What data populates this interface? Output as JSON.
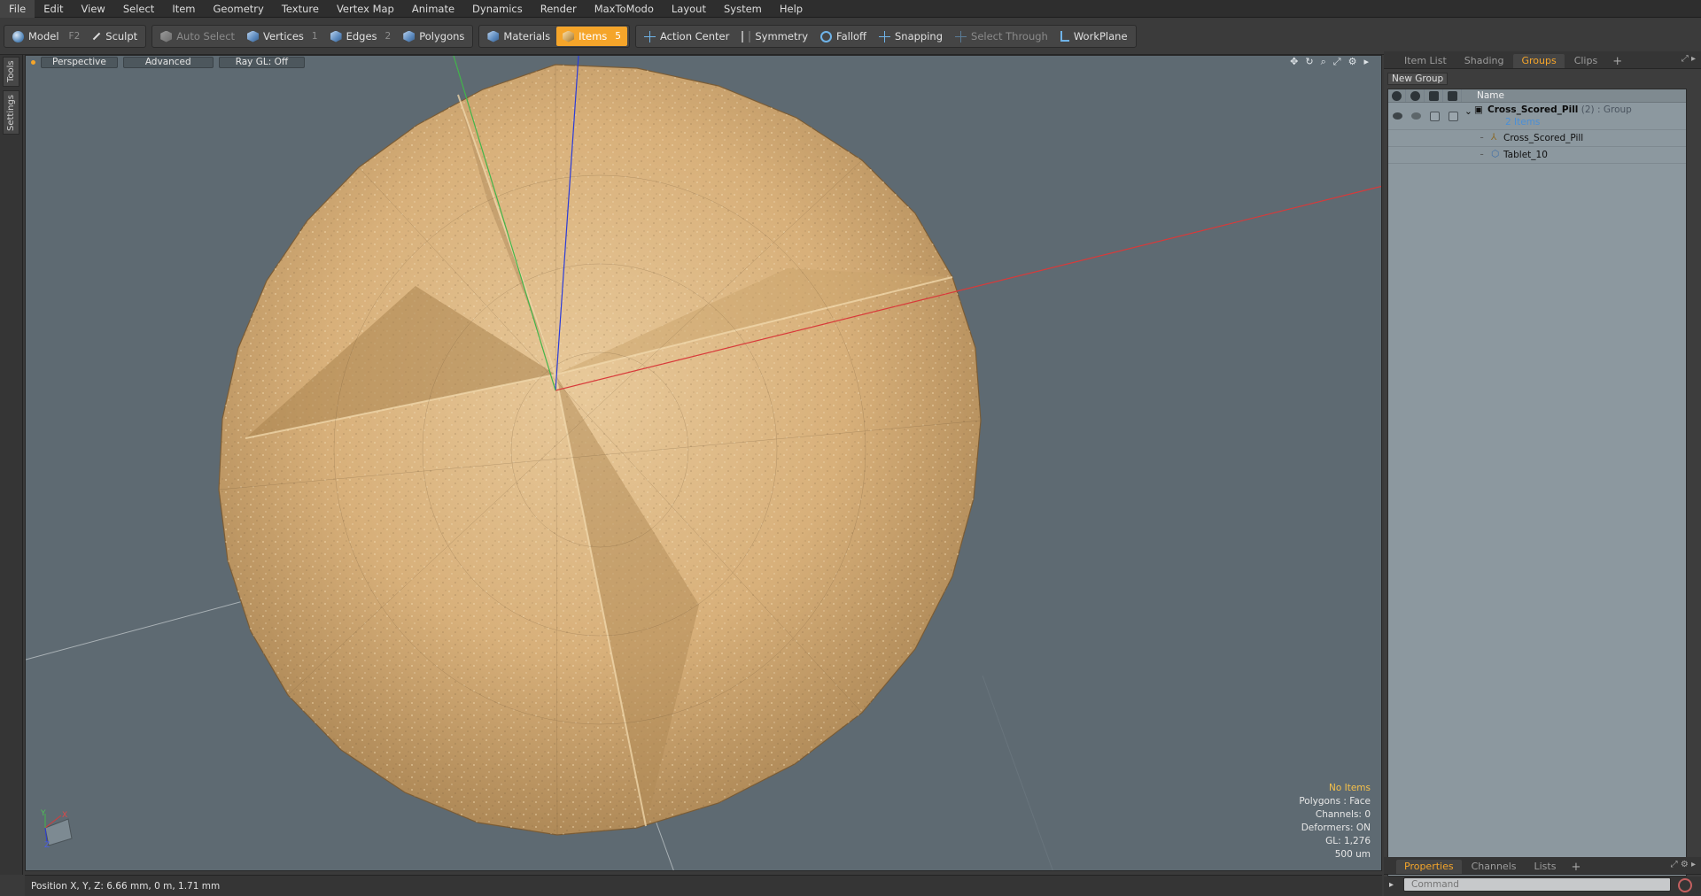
{
  "menu": [
    "File",
    "Edit",
    "View",
    "Select",
    "Item",
    "Geometry",
    "Texture",
    "Vertex Map",
    "Animate",
    "Dynamics",
    "Render",
    "MaxToModo",
    "Layout",
    "System",
    "Help"
  ],
  "toolbar": {
    "model_label": "Model",
    "model_key": "F2",
    "sculpt_label": "Sculpt",
    "auto_select_label": "Auto Select",
    "vertices_label": "Vertices",
    "vertices_num": "1",
    "edges_label": "Edges",
    "edges_num": "2",
    "polygons_label": "Polygons",
    "materials_label": "Materials",
    "items_label": "Items",
    "items_num": "5",
    "action_center_label": "Action Center",
    "symmetry_label": "Symmetry",
    "falloff_label": "Falloff",
    "snapping_label": "Snapping",
    "select_through_label": "Select Through",
    "workplane_label": "WorkPlane",
    "accent_color": "#f5a52a"
  },
  "left_tabs": [
    "Tools",
    "Settings"
  ],
  "viewport": {
    "view_label": "Perspective",
    "advanced_label": "Advanced",
    "raygl_label": "Ray GL: Off",
    "info": {
      "selection": "No Items",
      "polygons": "Polygons : Face",
      "channels": "Channels: 0",
      "deformers": "Deformers: ON",
      "gl": "GL: 1,276",
      "scale": "500 um"
    },
    "axis_x": "X",
    "axis_y": "Y",
    "axis_z": "Z",
    "background_color": "#5e6a72"
  },
  "status": {
    "position": "Position X, Y, Z:  6.66 mm, 0 m, 1.71 mm"
  },
  "right_panel": {
    "tabs": [
      "Item List",
      "Shading",
      "Groups",
      "Clips"
    ],
    "active_tab": "Groups",
    "new_group_label": "New Group",
    "name_header": "Name",
    "group": {
      "name": "Cross_Scored_Pill",
      "count": "(2)",
      "type": ": Group",
      "sub": "2 Items",
      "items": [
        "Cross_Scored_Pill",
        "Tablet_10"
      ]
    },
    "bottom_tabs": [
      "Properties",
      "Channels",
      "Lists"
    ],
    "command_placeholder": "Command"
  }
}
